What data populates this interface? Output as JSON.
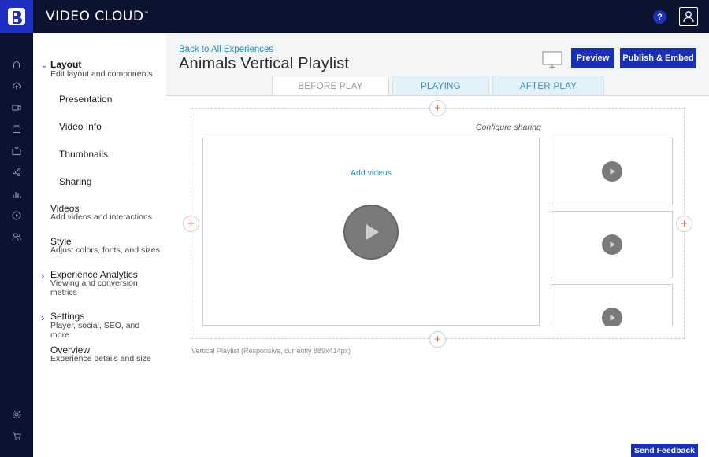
{
  "header": {
    "brand": "VIDEO CLOUD",
    "brand_mark": "™",
    "help_label": "?"
  },
  "sidebar": {
    "items": [
      {
        "label": "Layout",
        "sub": "Edit layout and components",
        "chevron": "⌄"
      },
      {
        "label": "Presentation"
      },
      {
        "label": "Video Info"
      },
      {
        "label": "Thumbnails"
      },
      {
        "label": "Sharing"
      },
      {
        "label": "Videos",
        "sub": "Add videos and interactions"
      },
      {
        "label": "Style",
        "sub": "Adjust colors, fonts, and sizes"
      },
      {
        "label": "Experience Analytics",
        "sub": "Viewing and conversion metrics",
        "chevron": "›"
      },
      {
        "label": "Settings",
        "sub": "Player, social, SEO, and more",
        "chevron": "›"
      },
      {
        "label": "Overview",
        "sub": "Experience details and size"
      }
    ]
  },
  "main": {
    "back_link": "Back to All Experiences",
    "title": "Animals Vertical Playlist",
    "preview_button": "Preview",
    "publish_button": "Publish & Embed",
    "tabs": [
      {
        "label": "BEFORE PLAY"
      },
      {
        "label": "PLAYING"
      },
      {
        "label": "AFTER PLAY"
      }
    ],
    "configure_sharing": "Configure sharing",
    "add_videos": "Add videos",
    "plus": "+",
    "caption": "Vertical Playlist (Responsive, currently 889x414px)"
  },
  "footer": {
    "feedback_button": "Send Feedback"
  },
  "colors": {
    "nav_bg": "#0c1330",
    "accent": "#1a2fb8",
    "link": "#1e8fb8",
    "plus": "#e8772e"
  }
}
